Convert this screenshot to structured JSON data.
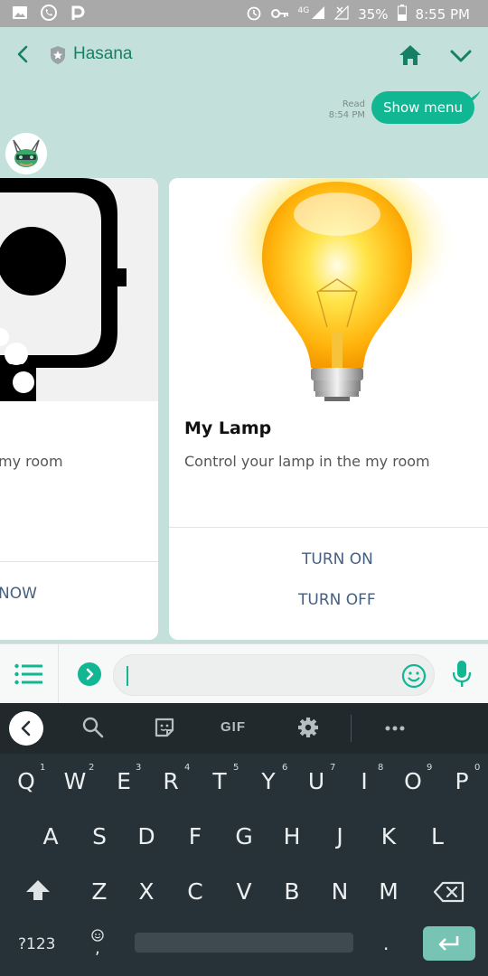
{
  "status_bar": {
    "network": "4G",
    "battery": "35%",
    "time": "8:55 PM"
  },
  "header": {
    "title": "Hasana"
  },
  "message": {
    "read_label": "Read",
    "read_time": "8:54 PM",
    "text": "Show menu"
  },
  "cards": [
    {
      "title": "",
      "description": "my room",
      "action": "NOW"
    },
    {
      "title": "My Lamp",
      "description": "Control your lamp in the my room",
      "actions": [
        "TURN ON",
        "TURN OFF"
      ]
    }
  ],
  "composer": {
    "value": ""
  },
  "keyboard": {
    "toolbar": {
      "gif": "GIF"
    },
    "row1": [
      {
        "k": "Q",
        "h": "1"
      },
      {
        "k": "W",
        "h": "2"
      },
      {
        "k": "E",
        "h": "3"
      },
      {
        "k": "R",
        "h": "4"
      },
      {
        "k": "T",
        "h": "5"
      },
      {
        "k": "Y",
        "h": "6"
      },
      {
        "k": "U",
        "h": "7"
      },
      {
        "k": "I",
        "h": "8"
      },
      {
        "k": "O",
        "h": "9"
      },
      {
        "k": "P",
        "h": "0"
      }
    ],
    "row2": [
      "A",
      "S",
      "D",
      "F",
      "G",
      "H",
      "J",
      "K",
      "L"
    ],
    "row3": [
      "Z",
      "X",
      "C",
      "V",
      "B",
      "N",
      "M"
    ],
    "symbols": "?123",
    "comma": ",",
    "period": "."
  },
  "colors": {
    "accent": "#11b692",
    "header_text": "#158066",
    "chat_background": "#c3e1da",
    "keyboard": "#263238"
  }
}
